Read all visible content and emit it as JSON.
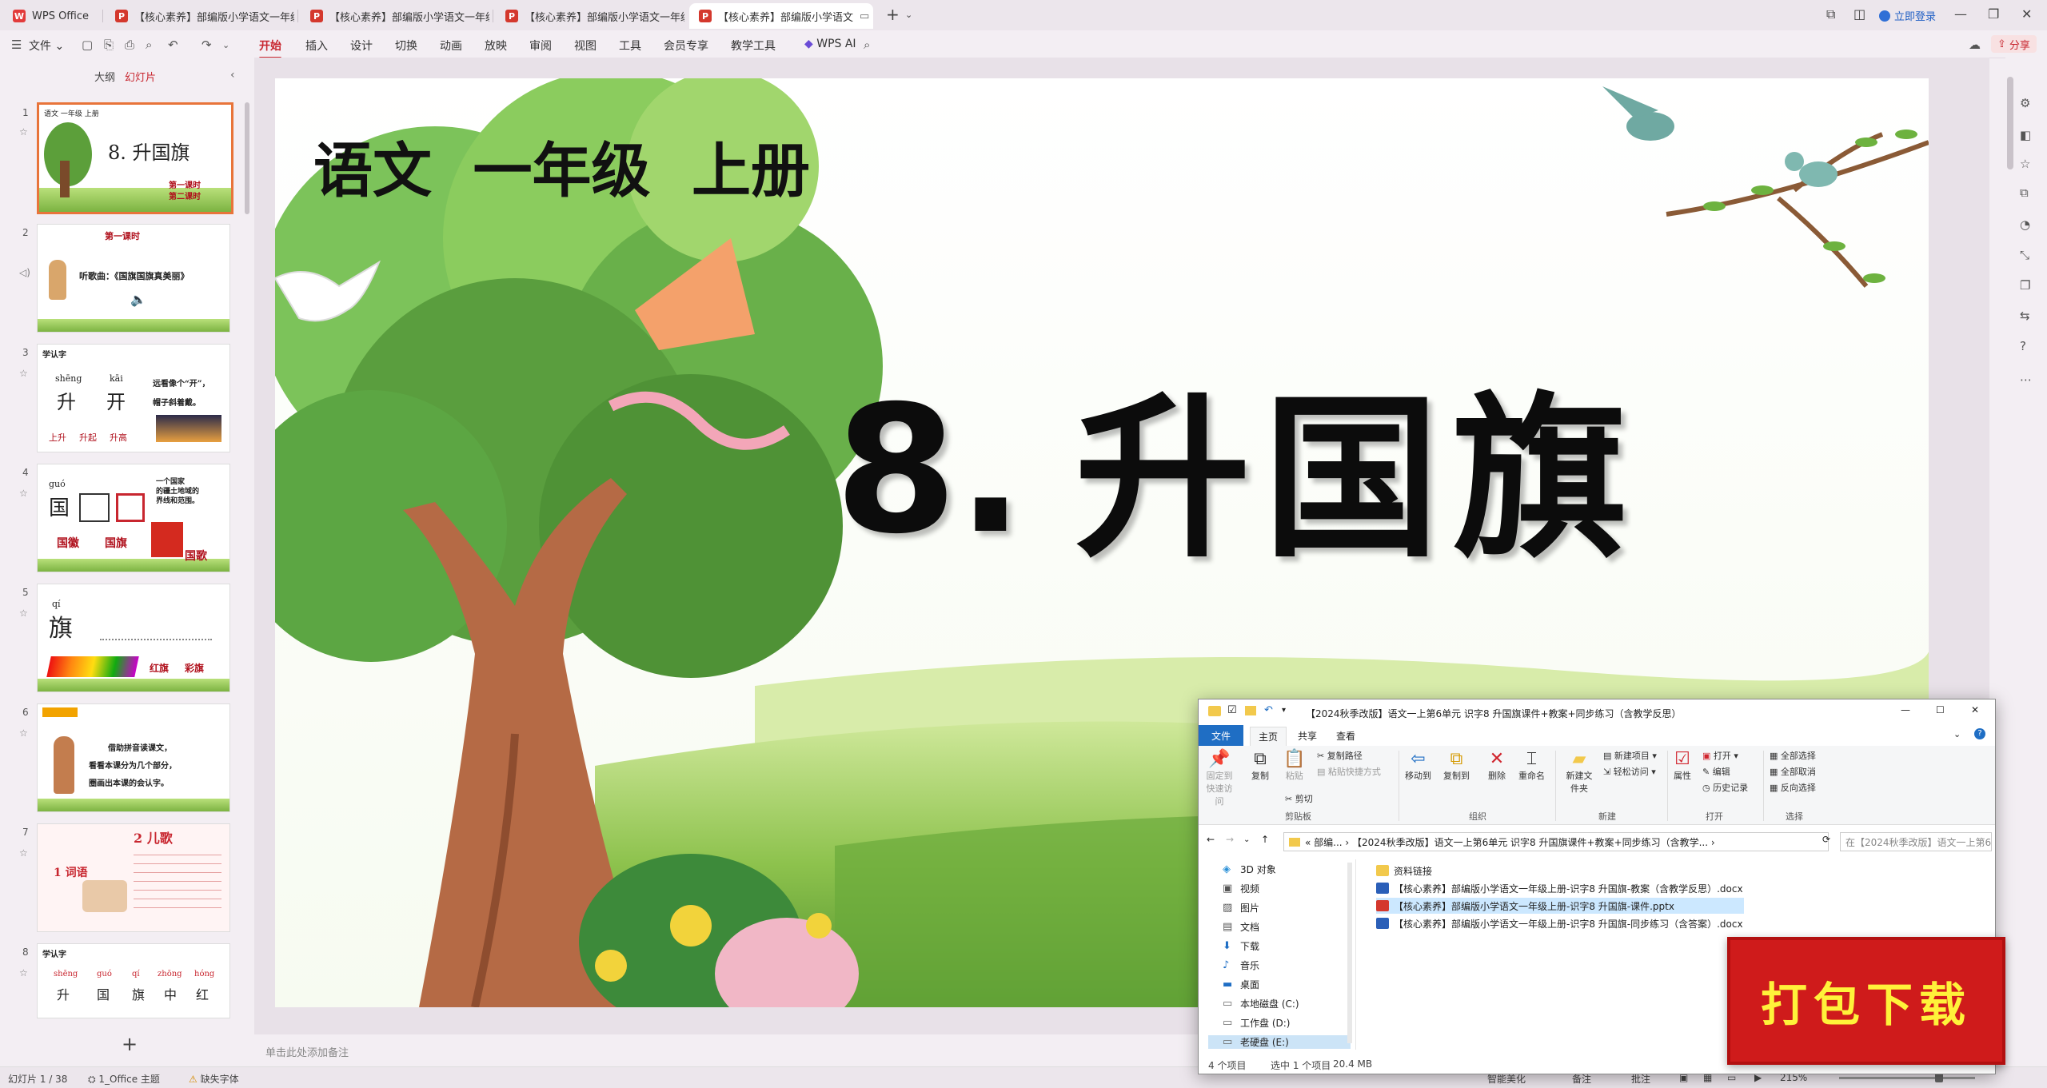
{
  "tabs": [
    {
      "label": "WPS Office",
      "kind": "home"
    },
    {
      "label": "【核心素养】部编版小学语文一年级...",
      "kind": "ppt"
    },
    {
      "label": "【核心素养】部编版小学语文一年级...",
      "kind": "ppt"
    },
    {
      "label": "【核心素养】部编版小学语文一年级...",
      "kind": "ppt"
    },
    {
      "label": "【核心素养】部编版小学语文",
      "kind": "ppt",
      "active": true
    }
  ],
  "tab_add": "+",
  "login": "立即登录",
  "menu": {
    "file": "文件",
    "items": [
      "开始",
      "插入",
      "设计",
      "切换",
      "动画",
      "放映",
      "审阅",
      "视图",
      "工具",
      "会员专享",
      "教学工具"
    ],
    "active": "开始",
    "wps_ai": "WPS AI",
    "share": "分享"
  },
  "panel": {
    "tabs": [
      "大纲",
      "幻灯片"
    ],
    "active_tab": "幻灯片",
    "add": "+"
  },
  "thumbnails": [
    {
      "num": "1",
      "lines": [
        "语文 一年级 上册",
        "8. 升国旗",
        "第一课时",
        "第二课时"
      ]
    },
    {
      "num": "2",
      "lines": [
        "第一课时",
        "听歌曲：《国旗国旗真美丽》"
      ]
    },
    {
      "num": "3",
      "lines": [
        "学认字",
        "shēng",
        "kāi",
        "升",
        "开",
        "远看像个“开”，",
        "帽子斜着戴。",
        "上升",
        "升起",
        "升高"
      ]
    },
    {
      "num": "4",
      "lines": [
        "guó",
        "国",
        "一个国家",
        "的疆土地域的",
        "界线和范围。",
        "国徽",
        "国旗",
        "国歌"
      ]
    },
    {
      "num": "5",
      "lines": [
        "qí",
        "旗",
        "红旗",
        "彩旗"
      ]
    },
    {
      "num": "6",
      "lines": [
        "借助拼音读课文，",
        "看看本课分为几个部分，",
        "圈画出本课的会认字。"
      ]
    },
    {
      "num": "7",
      "lines": [
        "1 词语",
        "2 儿歌"
      ]
    },
    {
      "num": "8",
      "lines": [
        "学认字",
        "shēng",
        "guó",
        "qí",
        "zhōng",
        "hóng",
        "升",
        "国",
        "旗",
        "中",
        "红"
      ]
    }
  ],
  "slide": {
    "subject": "语文  一年级  上册",
    "number": "8.",
    "title": "升国旗"
  },
  "notes_placeholder": "单击此处添加备注",
  "status": {
    "slide_pos": "幻灯片 1 / 38",
    "theme": "1_Office 主题",
    "font_warning": "缺失字体",
    "beautify": "智能美化",
    "notes": "备注",
    "comments": "批注",
    "zoom": "215%"
  },
  "explorer": {
    "title": "【2024秋季改版】语文一上第6单元 识字8 升国旗课件+教案+同步练习（含教学反思）",
    "tabs": [
      "文件",
      "主页",
      "共享",
      "查看"
    ],
    "ribbon": {
      "pin": "固定到快速访问",
      "copy": "复制",
      "paste": "粘贴",
      "copy_path": "复制路径",
      "paste_shortcut": "粘贴快捷方式",
      "cut": "剪切",
      "clipboard": "剪贴板",
      "move_to": "移动到",
      "copy_to": "复制到",
      "delete": "删除",
      "rename": "重命名",
      "organize": "组织",
      "new_folder": "新建文件夹",
      "new_item": "新建项目",
      "easy_access": "轻松访问",
      "new": "新建",
      "properties": "属性",
      "open": "打开",
      "edit": "编辑",
      "history": "历史记录",
      "open_group": "打开",
      "select_all": "全部选择",
      "select_none": "全部取消",
      "invert": "反向选择",
      "select": "选择"
    },
    "address": "« 部编... › 【2024秋季改版】语文一上第6单元 识字8 升国旗课件+教案+同步练习（含教学... ›",
    "search_placeholder": "在【2024秋季改版】语文一上第6...",
    "nav": [
      {
        "label": "3D 对象",
        "icon": "cube-icon"
      },
      {
        "label": "视频",
        "icon": "video-icon"
      },
      {
        "label": "图片",
        "icon": "image-icon"
      },
      {
        "label": "文档",
        "icon": "document-icon"
      },
      {
        "label": "下载",
        "icon": "download-icon"
      },
      {
        "label": "音乐",
        "icon": "music-icon"
      },
      {
        "label": "桌面",
        "icon": "desktop-icon"
      },
      {
        "label": "本地磁盘 (C:)",
        "icon": "drive-icon"
      },
      {
        "label": "工作盘 (D:)",
        "icon": "drive-icon"
      },
      {
        "label": "老硬盘 (E:)",
        "icon": "drive-icon",
        "selected": true
      }
    ],
    "files": [
      {
        "name": "资料链接",
        "type": "folder"
      },
      {
        "name": "【核心素养】部编版小学语文一年级上册-识字8 升国旗-教案（含教学反思）.docx",
        "type": "docx"
      },
      {
        "name": "【核心素养】部编版小学语文一年级上册-识字8 升国旗-课件.pptx",
        "type": "pptx",
        "selected": true
      },
      {
        "name": "【核心素养】部编版小学语文一年级上册-识字8 升国旗-同步练习（含答案）.docx",
        "type": "docx"
      }
    ],
    "status": {
      "count": "4 个项目",
      "selected": "选中 1 个项目",
      "size": "20.4 MB"
    }
  },
  "download_badge": "打包下载",
  "colors": {
    "accent": "#c8262f",
    "badge": "#cf1b1b",
    "badge_text": "#fff23a",
    "explorer_blue": "#1f6ec4"
  }
}
